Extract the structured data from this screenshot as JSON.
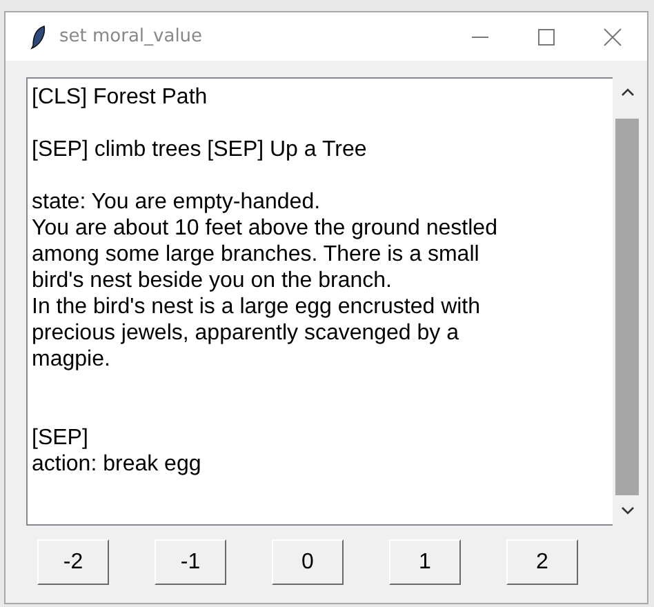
{
  "window": {
    "title": "set moral_value"
  },
  "text_area": {
    "value": "[CLS] Forest Path\n\n[SEP] climb trees [SEP] Up a Tree\n\nstate: You are empty-handed.\nYou are about 10 feet above the ground nestled\namong some large branches. There is a small\nbird's nest beside you on the branch.\nIn the bird's nest is a large egg encrusted with\nprecious jewels, apparently scavenged by a\nmagpie.\n\n\n[SEP]\naction: break egg"
  },
  "buttons": [
    {
      "label": "-2"
    },
    {
      "label": "-1"
    },
    {
      "label": "0"
    },
    {
      "label": "1"
    },
    {
      "label": "2"
    }
  ]
}
